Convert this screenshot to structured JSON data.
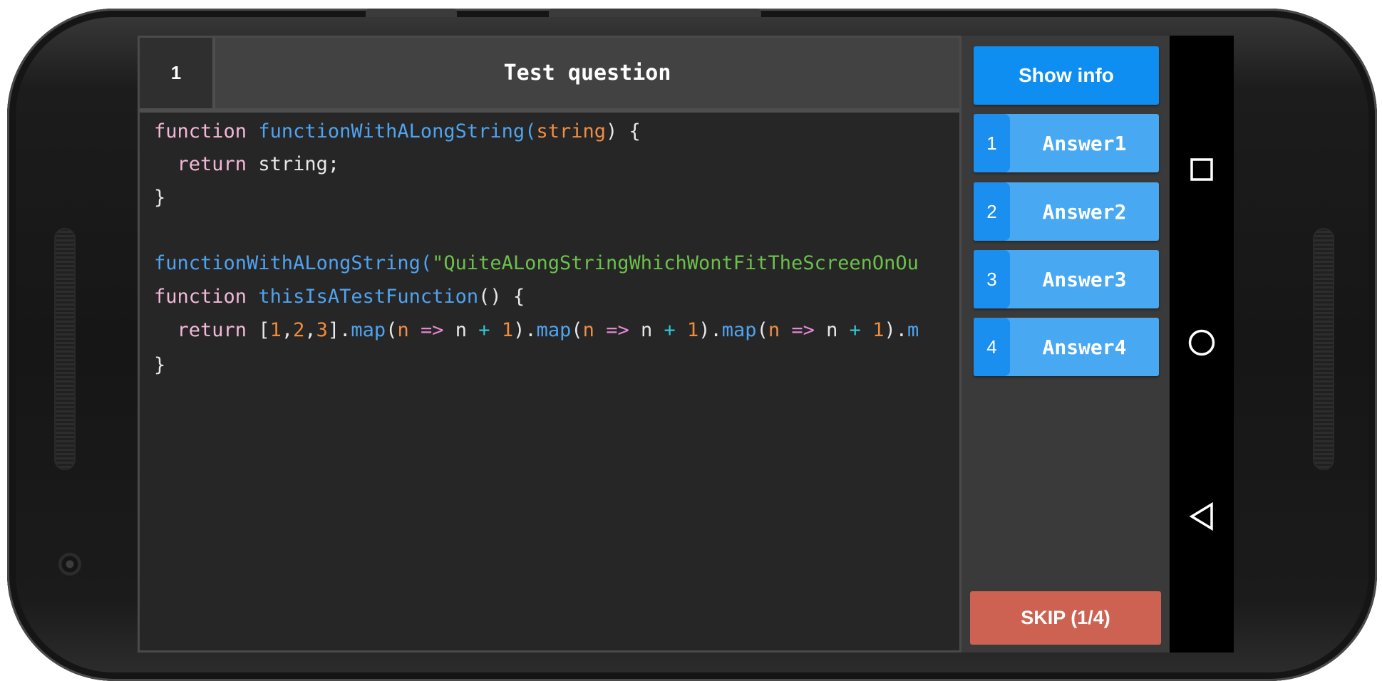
{
  "question": {
    "number": "1",
    "title": "Test question"
  },
  "code_lines": [
    [
      {
        "t": "function",
        "c": "kw"
      },
      {
        "t": " "
      },
      {
        "t": "functionWithALongString",
        "c": "fn"
      },
      {
        "t": "(",
        "c": "fn"
      },
      {
        "t": "string",
        "c": "arg"
      },
      {
        "t": ") {"
      }
    ],
    [
      {
        "t": "  "
      },
      {
        "t": "return",
        "c": "kw"
      },
      {
        "t": " string;"
      }
    ],
    [
      {
        "t": "}"
      }
    ],
    [],
    [
      {
        "t": "functionWithALongString(",
        "c": "fn"
      },
      {
        "t": "\"QuiteALongStringWhichWontFitTheScreenOnOu",
        "c": "str"
      }
    ],
    [
      {
        "t": "function",
        "c": "kw"
      },
      {
        "t": " "
      },
      {
        "t": "thisIsATestFunction",
        "c": "fn"
      },
      {
        "t": "() {"
      }
    ],
    [
      {
        "t": "  "
      },
      {
        "t": "return",
        "c": "kw"
      },
      {
        "t": " ["
      },
      {
        "t": "1",
        "c": "num"
      },
      {
        "t": ","
      },
      {
        "t": "2",
        "c": "num"
      },
      {
        "t": ","
      },
      {
        "t": "3",
        "c": "num"
      },
      {
        "t": "]."
      },
      {
        "t": "map",
        "c": "fn"
      },
      {
        "t": "("
      },
      {
        "t": "n",
        "c": "arg"
      },
      {
        "t": " "
      },
      {
        "t": "=>",
        "c": "op"
      },
      {
        "t": " n "
      },
      {
        "t": "+",
        "c": "plus"
      },
      {
        "t": " "
      },
      {
        "t": "1",
        "c": "num"
      },
      {
        "t": ")."
      },
      {
        "t": "map",
        "c": "fn"
      },
      {
        "t": "("
      },
      {
        "t": "n",
        "c": "arg"
      },
      {
        "t": " "
      },
      {
        "t": "=>",
        "c": "op"
      },
      {
        "t": " n "
      },
      {
        "t": "+",
        "c": "plus"
      },
      {
        "t": " "
      },
      {
        "t": "1",
        "c": "num"
      },
      {
        "t": ")."
      },
      {
        "t": "map",
        "c": "fn"
      },
      {
        "t": "("
      },
      {
        "t": "n",
        "c": "arg"
      },
      {
        "t": " "
      },
      {
        "t": "=>",
        "c": "op"
      },
      {
        "t": " n "
      },
      {
        "t": "+",
        "c": "plus"
      },
      {
        "t": " "
      },
      {
        "t": "1",
        "c": "num"
      },
      {
        "t": ")."
      },
      {
        "t": "m",
        "c": "fn"
      }
    ],
    [
      {
        "t": "}"
      }
    ]
  ],
  "sidebar": {
    "show_info_label": "Show info",
    "answers": [
      {
        "num": "1",
        "label": "Answer1"
      },
      {
        "num": "2",
        "label": "Answer2"
      },
      {
        "num": "3",
        "label": "Answer3"
      },
      {
        "num": "4",
        "label": "Answer4"
      }
    ],
    "skip_label": "SKIP (1/4)"
  },
  "navbar": {
    "icons": [
      "recents-square-icon",
      "home-circle-icon",
      "back-triangle-icon"
    ]
  },
  "colors": {
    "primary": "#0f8ef2",
    "answer": "#49a8f2",
    "answer_number": "#1a8ff0",
    "skip": "#cd6252"
  }
}
